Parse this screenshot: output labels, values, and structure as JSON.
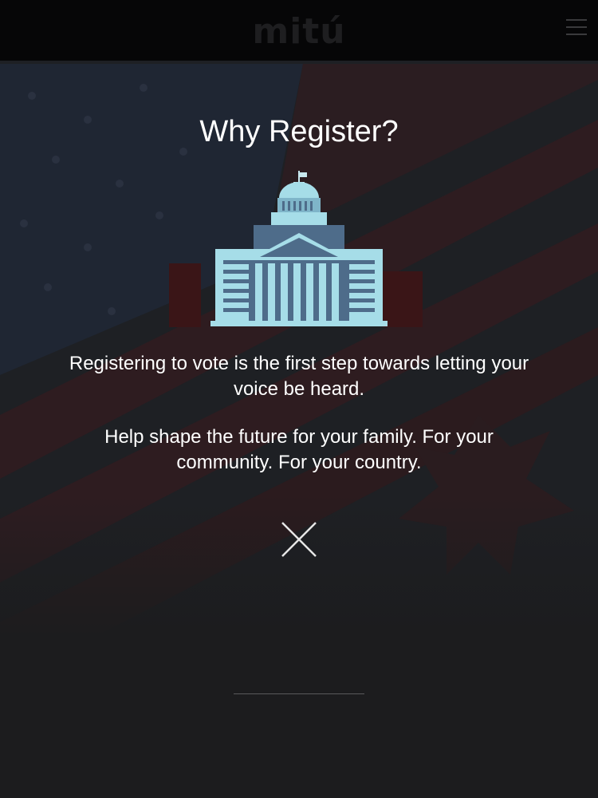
{
  "header": {
    "logo_text": "mitú",
    "menu_icon": "hamburger-menu-icon"
  },
  "modal": {
    "title": "Why Register?",
    "illustration_icon": "capitol-building-icon",
    "paragraph_1": "Registering to vote is the first step towards letting your voice be heard.",
    "paragraph_2": "Help shape the future for your family. For your community. For your country.",
    "close_icon": "close-icon"
  },
  "colors": {
    "background": "#1c1c1e",
    "header": "#060607",
    "text": "#ffffff",
    "building_light": "#a6dde8",
    "building_dark": "#4e6c8a",
    "building_mid": "#7fb5c9"
  }
}
